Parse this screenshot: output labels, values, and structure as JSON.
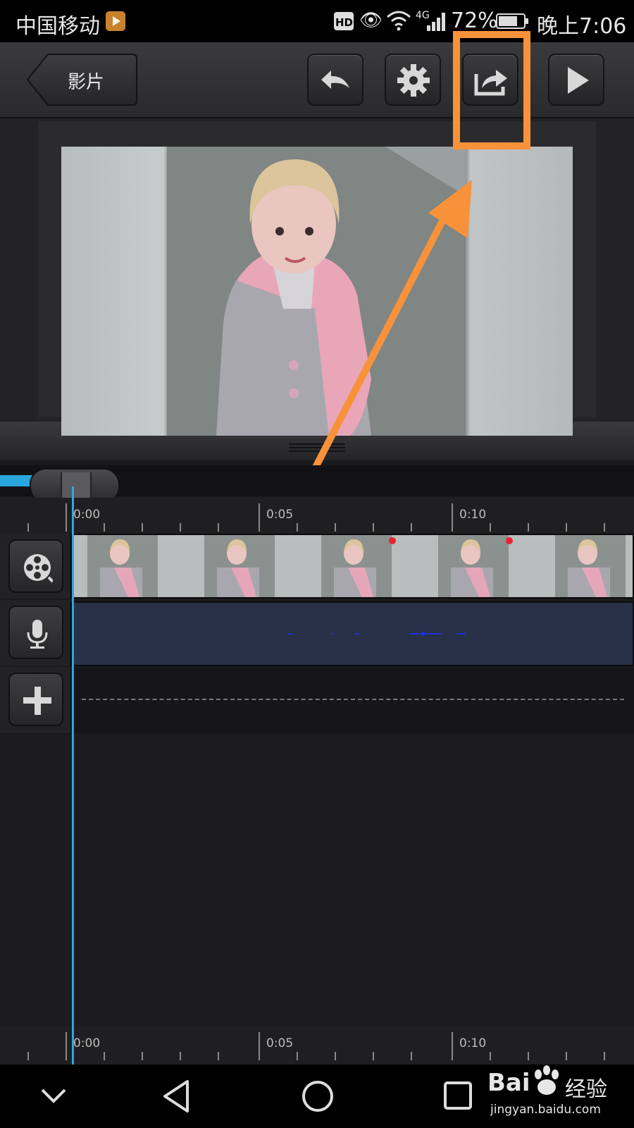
{
  "status_bar": {
    "carrier": "中国移动",
    "hd": "HD",
    "network": "4G",
    "battery": "72%",
    "time": "晚上7:06"
  },
  "toolbar": {
    "back_label": "影片",
    "buttons": [
      "undo-icon",
      "settings-icon",
      "share-export-icon",
      "play-icon"
    ],
    "highlight_color": "#f7923a"
  },
  "timeline": {
    "ruler_labels": [
      "0:00",
      "0:05",
      "0:10"
    ],
    "track_icons": [
      "film-reel-icon",
      "microphone-icon",
      "plus-icon"
    ],
    "accent_color": "#2aa9df"
  },
  "watermark": {
    "brand": "Bai",
    "product": "经验",
    "url": "jingyan.baidu.com"
  }
}
